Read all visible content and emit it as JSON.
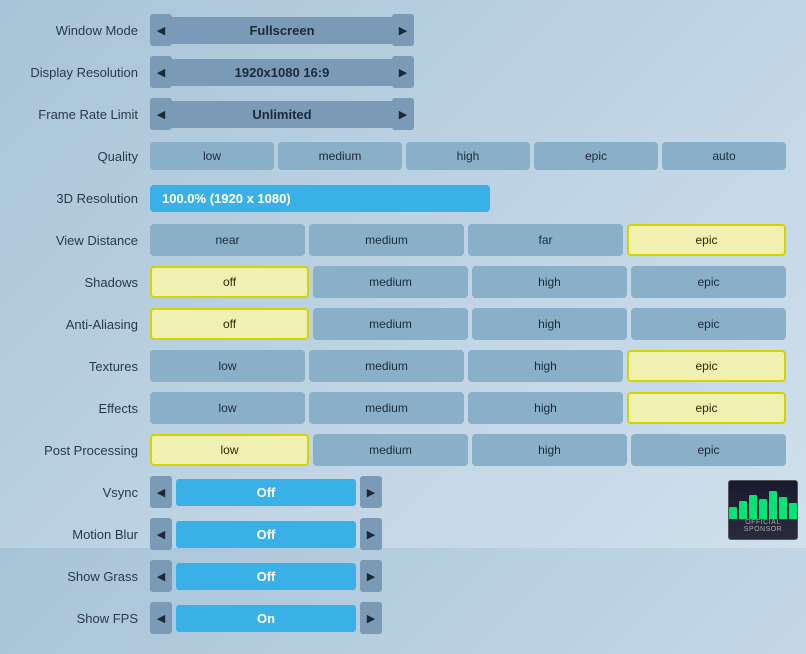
{
  "labels": {
    "window_mode": "Window Mode",
    "display_resolution": "Display Resolution",
    "frame_rate_limit": "Frame Rate Limit",
    "quality": "Quality",
    "three_d_resolution": "3D Resolution",
    "view_distance": "View Distance",
    "shadows": "Shadows",
    "anti_aliasing": "Anti-Aliasing",
    "textures": "Textures",
    "effects": "Effects",
    "post_processing": "Post Processing",
    "vsync": "Vsync",
    "motion_blur": "Motion Blur",
    "show_grass": "Show Grass",
    "show_fps": "Show FPS"
  },
  "values": {
    "window_mode": "Fullscreen",
    "display_resolution": "1920x1080 16:9",
    "frame_rate_limit": "Unlimited",
    "three_d_resolution": "100.0% (1920 x 1080)",
    "vsync": "Off",
    "motion_blur": "Off",
    "show_grass": "Off",
    "show_fps": "On"
  },
  "quality_options": [
    "low",
    "medium",
    "high",
    "epic",
    "auto"
  ],
  "quality_selected": "high",
  "view_distance_options": [
    "near",
    "medium",
    "far",
    "epic"
  ],
  "view_distance_selected": "epic",
  "shadows_options": [
    "off",
    "medium",
    "high",
    "epic"
  ],
  "shadows_selected": "off",
  "anti_aliasing_options": [
    "off",
    "medium",
    "high",
    "epic"
  ],
  "anti_aliasing_selected": "off",
  "textures_options": [
    "low",
    "medium",
    "high",
    "epic"
  ],
  "textures_selected": "epic",
  "effects_options": [
    "low",
    "medium",
    "high",
    "epic"
  ],
  "effects_selected": "epic",
  "post_processing_options": [
    "low",
    "medium",
    "high",
    "epic"
  ],
  "post_processing_selected": "low",
  "sponsor": {
    "text": "OFFICIAL SPONSOR",
    "bars": [
      12,
      18,
      24,
      20,
      28,
      22,
      16
    ]
  }
}
